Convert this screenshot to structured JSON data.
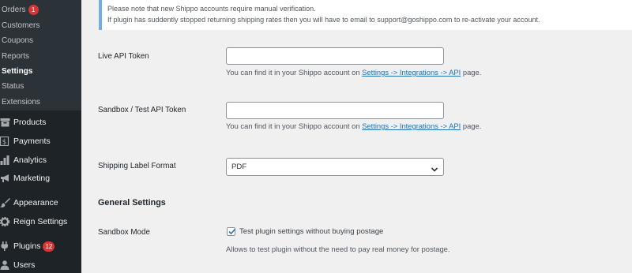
{
  "sidebar": {
    "submenu": [
      {
        "label": "Orders",
        "badge": "1"
      },
      {
        "label": "Customers"
      },
      {
        "label": "Coupons"
      },
      {
        "label": "Reports"
      },
      {
        "label": "Settings",
        "current": true
      },
      {
        "label": "Status"
      },
      {
        "label": "Extensions"
      }
    ],
    "menu": [
      {
        "label": "Products",
        "icon": "archive-icon"
      },
      {
        "label": "Payments",
        "icon": "dollar-icon"
      },
      {
        "label": "Analytics",
        "icon": "bar-chart-icon"
      },
      {
        "label": "Marketing",
        "icon": "megaphone-icon"
      },
      {
        "label": "Appearance",
        "icon": "paintbrush-icon"
      },
      {
        "label": "Reign Settings",
        "icon": "gear-icon"
      },
      {
        "label": "Plugins",
        "icon": "plug-icon",
        "badge": "12"
      },
      {
        "label": "Users",
        "icon": "user-icon"
      }
    ]
  },
  "notice": {
    "line1": "Please note that new Shippo accounts require manual verification.",
    "line2": "If plugin has suddently stopped returning shipping rates then you will have to email to support@goshippo.com to re-activate your account."
  },
  "form": {
    "live_token": {
      "label": "Live API Token",
      "value": "",
      "desc_prefix": "You can find it in your Shippo account on ",
      "desc_link": "Settings -> Integrations -> API",
      "desc_suffix": " page."
    },
    "sandbox_token": {
      "label": "Sandbox / Test API Token",
      "value": "",
      "desc_prefix": "You can find it in your Shippo account on ",
      "desc_link": "Settings -> Integrations -> API",
      "desc_suffix": " page."
    },
    "label_format": {
      "label": "Shipping Label Format",
      "selected": "PDF"
    },
    "general_settings_title": "General Settings",
    "sandbox_mode": {
      "label": "Sandbox Mode",
      "checked": true,
      "checkbox_label": "Test plugin settings without buying postage",
      "desc": "Allows to test plugin without the need to pay real money for postage."
    }
  },
  "colors": {
    "sidebar_bg": "#1d2327",
    "submenu_bg": "#2c3338",
    "badge": "#d63638",
    "link": "#2271b1",
    "notice_border": "#72aee6"
  }
}
